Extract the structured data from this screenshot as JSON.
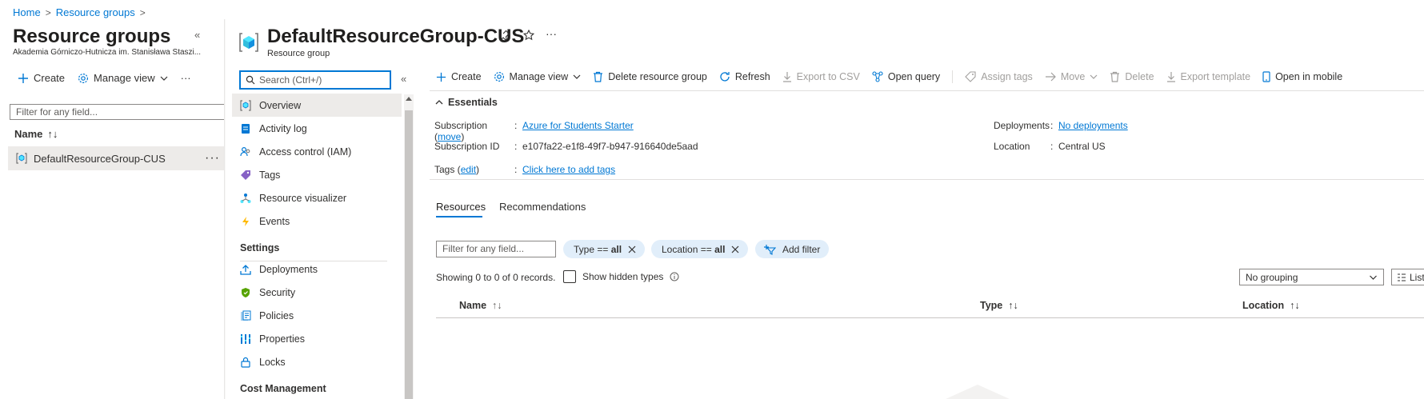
{
  "breadcrumb": {
    "home": "Home",
    "resource_groups": "Resource groups",
    "sep": ">"
  },
  "left_blade": {
    "title": "Resource groups",
    "subtitle": "Akademia Górniczo-Hutnicza im. Stanisława Staszi...",
    "toolbar": {
      "create": "Create",
      "manage_view": "Manage view",
      "more": "···"
    },
    "filter_placeholder": "Filter for any field...",
    "name_column": "Name",
    "rows": [
      {
        "name": "DefaultResourceGroup-CUS"
      }
    ]
  },
  "header": {
    "title": "DefaultResourceGroup-CUS",
    "subtitle": "Resource group",
    "more": "···"
  },
  "menu": {
    "search_placeholder": "Search (Ctrl+/)",
    "items": [
      {
        "label": "Overview",
        "icon": "resource-group-icon"
      },
      {
        "label": "Activity log",
        "icon": "activity-log-icon"
      },
      {
        "label": "Access control (IAM)",
        "icon": "people-icon"
      },
      {
        "label": "Tags",
        "icon": "tag-icon"
      },
      {
        "label": "Resource visualizer",
        "icon": "visualizer-icon"
      },
      {
        "label": "Events",
        "icon": "lightning-icon"
      }
    ],
    "settings_heading": "Settings",
    "settings_items": [
      {
        "label": "Deployments",
        "icon": "upload-icon"
      },
      {
        "label": "Security",
        "icon": "shield-icon"
      },
      {
        "label": "Policies",
        "icon": "policy-icon"
      },
      {
        "label": "Properties",
        "icon": "properties-icon"
      },
      {
        "label": "Locks",
        "icon": "lock-icon"
      }
    ],
    "cost_heading": "Cost Management"
  },
  "commands": {
    "create": "Create",
    "manage_view": "Manage view",
    "delete_group": "Delete resource group",
    "refresh": "Refresh",
    "export_csv": "Export to CSV",
    "open_query": "Open query",
    "assign_tags": "Assign tags",
    "move": "Move",
    "delete": "Delete",
    "export_template": "Export template",
    "open_mobile": "Open in mobile"
  },
  "essentials": {
    "heading": "Essentials",
    "subscription_label_prefix": "Subscription (",
    "subscription_move": "move",
    "subscription_label_suffix": ")",
    "subscription_value": "Azure for Students Starter",
    "subscription_id_label": "Subscription ID",
    "subscription_id_value": "e107fa22-e1f8-49f7-b947-916640de5aad",
    "tags_label_prefix": "Tags (",
    "tags_edit": "edit",
    "tags_label_suffix": ")",
    "tags_value": "Click here to add tags",
    "deployments_label": "Deployments",
    "deployments_value": "No deployments",
    "location_label": "Location",
    "location_value": "Central US",
    "colon": ":"
  },
  "tabs": {
    "resources": "Resources",
    "recommendations": "Recommendations"
  },
  "filters": {
    "placeholder": "Filter for any field...",
    "type_prefix": "Type == ",
    "type_value": "all",
    "location_prefix": "Location == ",
    "location_value": "all",
    "add_filter": "Add filter"
  },
  "records": {
    "text": "Showing 0 to 0 of 0 records.",
    "show_hidden": "Show hidden types",
    "grouping": "No grouping",
    "list_view": "List"
  },
  "table": {
    "columns": [
      "Name",
      "Type",
      "Location"
    ]
  },
  "colors": {
    "accent": "#0078d4",
    "selected_bg": "#edebe9",
    "pill_bg": "#e1eefa"
  }
}
